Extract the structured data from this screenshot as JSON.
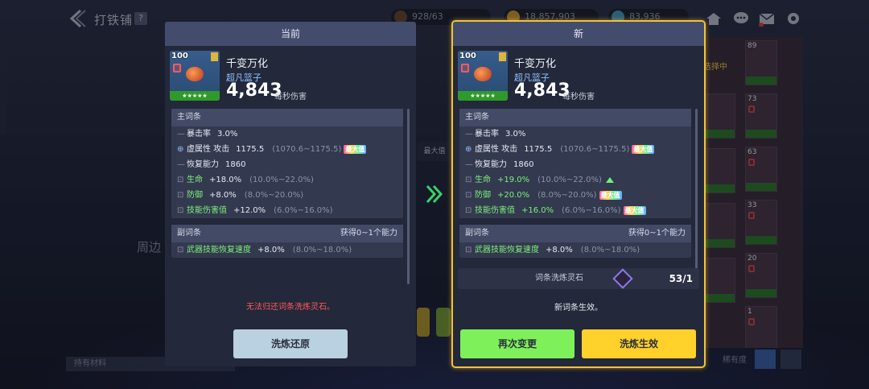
{
  "header": {
    "title": "打铁铺",
    "help": "?"
  },
  "currencies": [
    {
      "value": "928/63",
      "color": "#6b4a2e"
    },
    {
      "value": "18,857,903",
      "color": "#d9a032"
    },
    {
      "value": "83,936",
      "color": "#46a2c8"
    }
  ],
  "background": {
    "left_text_1": "周边",
    "hold_label": "持有材料",
    "sort_label": "稀有度",
    "badge_label": "选择中",
    "right_tag": "最大值"
  },
  "grid": [
    {
      "num": "89",
      "lock": false
    },
    {
      "num": "73",
      "lock": true
    },
    {
      "num": "63",
      "lock": true
    },
    {
      "num": "33",
      "lock": true
    },
    {
      "num": "20",
      "lock": true
    },
    {
      "num": "1",
      "lock": true
    }
  ],
  "left_panel": {
    "header": "当前",
    "item": {
      "level": "100",
      "name": "千变万化",
      "type": "超凡篮子",
      "damage": "4,843",
      "damage_label": "每秒伤害",
      "stars": "★★★★★"
    },
    "main_label": "主词条",
    "main_stats": [
      {
        "prefix": "—",
        "key": "暴击率",
        "value": "3.0%",
        "range": "",
        "tag": "",
        "lock": false
      },
      {
        "prefix": "lock",
        "key": "虚属性 攻击",
        "value": "1175.5",
        "range": "(1070.6~1175.5)",
        "tag": "最大值",
        "lock": true
      },
      {
        "prefix": "—",
        "key": "恢复能力",
        "value": "1860",
        "range": "",
        "tag": "",
        "lock": false
      },
      {
        "prefix": "lock",
        "key": "生命",
        "value": "+18.0%",
        "range": "(10.0%~22.0%)",
        "tag": "",
        "lock": true
      },
      {
        "prefix": "lock",
        "key": "防御",
        "value": "+8.0%",
        "range": "(8.0%~20.0%)",
        "tag": "",
        "lock": true
      },
      {
        "prefix": "lock",
        "key": "技能伤害值",
        "value": "+12.0%",
        "range": "(6.0%~16.0%)",
        "tag": "",
        "lock": true
      }
    ],
    "sub_label": "副词条",
    "sub_right": "获得0~1个能力",
    "sub_stats": [
      {
        "key": "武器技能恢复速度",
        "value": "+8.0%",
        "range": "(8.0%~18.0%)"
      }
    ],
    "warning": "无法归还词条洗炼灵石。",
    "button": "洗炼还原"
  },
  "right_panel": {
    "header": "新",
    "item": {
      "level": "100",
      "name": "千变万化",
      "type": "超凡篮子",
      "damage": "4,843",
      "damage_label": "每秒伤害",
      "stars": "★★★★★"
    },
    "main_label": "主词条",
    "main_stats": [
      {
        "key": "暴击率",
        "value": "3.0%",
        "range": "",
        "tag": "",
        "up": false,
        "green": false
      },
      {
        "key": "虚属性 攻击",
        "value": "1175.5",
        "range": "(1070.6~1175.5)",
        "tag": "最大值",
        "up": false,
        "green": false
      },
      {
        "key": "恢复能力",
        "value": "1860",
        "range": "",
        "tag": "",
        "up": false,
        "green": false
      },
      {
        "key": "生命",
        "value": "+19.0%",
        "range": "(10.0%~22.0%)",
        "tag": "",
        "up": true,
        "green": true
      },
      {
        "key": "防御",
        "value": "+20.0%",
        "range": "(8.0%~20.0%)",
        "tag": "最大值",
        "up": false,
        "green": true
      },
      {
        "key": "技能伤害值",
        "value": "+16.0%",
        "range": "(6.0%~16.0%)",
        "tag": "最大值",
        "up": false,
        "green": true
      }
    ],
    "sub_label": "副词条",
    "sub_right": "获得0~1个能力",
    "sub_stats": [
      {
        "key": "武器技能恢复速度",
        "value": "+8.0%",
        "range": "(8.0%~18.0%)"
      }
    ],
    "stone_label": "词条洗炼灵石",
    "stone_count": "53/1",
    "effect_text": "新词条生效。",
    "button_change": "再次变更",
    "button_apply": "洗炼生效"
  },
  "colors": {
    "gold": "#f2c23a",
    "green_btn": "#7ef05a",
    "yellow_btn": "#ffd12a",
    "restore_btn": "#b9d1e0"
  }
}
